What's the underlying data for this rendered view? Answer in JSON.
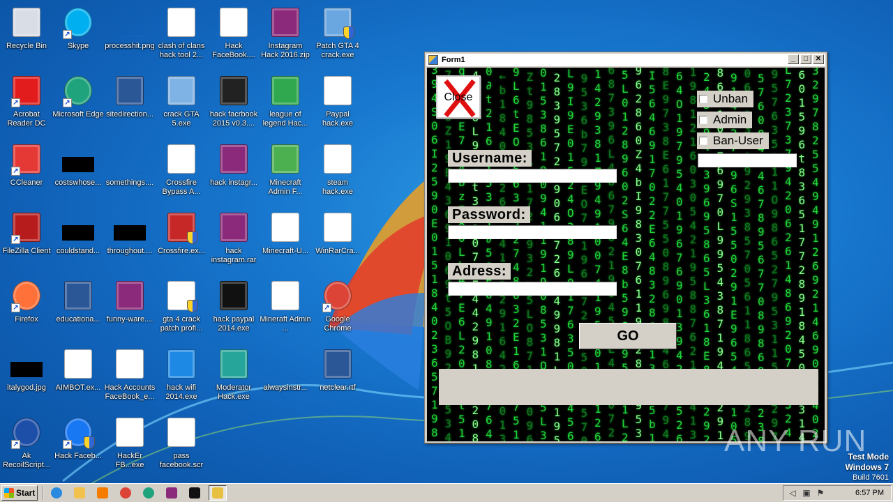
{
  "desktop": {
    "icons": [
      {
        "label": "Recycle Bin",
        "icon": "recycle-bin-icon",
        "color": "#d8dde6"
      },
      {
        "label": "Skype",
        "icon": "skype-icon",
        "color": "#00aff0"
      },
      {
        "label": "processhit.png",
        "icon": "image-file-icon",
        "color": "#1565c0"
      },
      {
        "label": "clash of clans hack tool 2...",
        "icon": "window-app-icon",
        "color": "#ffffff"
      },
      {
        "label": "Hack FaceBook....",
        "icon": "video-file-icon",
        "color": "#ffffff"
      },
      {
        "label": "Instagram Hack 2016.zip",
        "icon": "winrar-icon",
        "color": "#8b2a7a"
      },
      {
        "label": "Patch GTA 4 crack.exe",
        "icon": "installer-icon",
        "color": "#6aa6e0"
      },
      {
        "label": "Acrobat Reader DC",
        "icon": "acrobat-icon",
        "color": "#e21c1c"
      },
      {
        "label": "Microsoft Edge",
        "icon": "edge-icon",
        "color": "#1fa37d"
      },
      {
        "label": "sitedirection...",
        "icon": "word-doc-icon",
        "color": "#2b5797"
      },
      {
        "label": "crack GTA 5.exe",
        "icon": "media-exe-icon",
        "color": "#7fb2e5"
      },
      {
        "label": "hack facrbook 2015  v0.3....",
        "icon": "dark-image-icon",
        "color": "#222222"
      },
      {
        "label": "league of legend Hac...",
        "icon": "shield-check-icon",
        "color": "#2fa84f"
      },
      {
        "label": "Paypal hack.exe",
        "icon": "exe-file-icon",
        "color": "#ffffff"
      },
      {
        "label": "CCleaner",
        "icon": "ccleaner-icon",
        "color": "#e53935"
      },
      {
        "label": "costswhose...",
        "icon": "black-image-icon",
        "color": "#000000"
      },
      {
        "label": "somethings....",
        "icon": "image-file-icon",
        "color": "#1565c0"
      },
      {
        "label": "Crossfire Bypass A...",
        "icon": "window-app-icon",
        "color": "#ffffff"
      },
      {
        "label": "hack instagr...",
        "icon": "winrar-icon",
        "color": "#8b2a7a"
      },
      {
        "label": "Minecraft Admin F...",
        "icon": "droplet-icon",
        "color": "#4caf50"
      },
      {
        "label": "steam hack.exe",
        "icon": "exe-file-icon",
        "color": "#ffffff"
      },
      {
        "label": "FileZilla Client",
        "icon": "filezilla-icon",
        "color": "#b71c1c"
      },
      {
        "label": "couldstand...",
        "icon": "black-image-icon",
        "color": "#000000"
      },
      {
        "label": "throughout....",
        "icon": "black-image-icon",
        "color": "#000000"
      },
      {
        "label": "Crossfire.ex...",
        "icon": "crossfire-icon",
        "color": "#c62828"
      },
      {
        "label": "hack instagram.rar",
        "icon": "winrar-icon",
        "color": "#8b2a7a"
      },
      {
        "label": "Minecraft-U...",
        "icon": "window-app-icon",
        "color": "#ffffff"
      },
      {
        "label": "WinRarCra...",
        "icon": "exe-file-icon",
        "color": "#ffffff"
      },
      {
        "label": "Firefox",
        "icon": "firefox-icon",
        "color": "#ff7139"
      },
      {
        "label": "educationa...",
        "icon": "word-doc-icon",
        "color": "#2b5797"
      },
      {
        "label": "funny-ware....",
        "icon": "winrar-icon",
        "color": "#8b2a7a"
      },
      {
        "label": "gta 4 crack patch profi...",
        "icon": "installer-icon",
        "color": "#ffffff"
      },
      {
        "label": "hack paypal 2014.exe",
        "icon": "pirate-icon",
        "color": "#111111"
      },
      {
        "label": "Mineraft Admin ...",
        "icon": "exe-file-icon",
        "color": "#ffffff"
      },
      {
        "label": "Google Chrome",
        "icon": "chrome-icon",
        "color": "#db4437"
      },
      {
        "label": "italygod.jpg",
        "icon": "black-image-icon",
        "color": "#000000"
      },
      {
        "label": "AIMBOT.ex...",
        "icon": "gear-file-icon",
        "color": "#ffffff"
      },
      {
        "label": "Hack Accounts FaceBook_e...",
        "icon": "exe-file-icon",
        "color": "#ffffff"
      },
      {
        "label": "hack wifi 2014.exe",
        "icon": "wifi-icon",
        "color": "#1e88e5"
      },
      {
        "label": "Moderator Hack.exe",
        "icon": "cartoon-icon",
        "color": "#26a69a"
      },
      {
        "label": "alwaysinstr...",
        "icon": "image-file-icon",
        "color": "#1565c0"
      },
      {
        "label": "netclear.rtf",
        "icon": "word-doc-icon",
        "color": "#2b5797"
      },
      {
        "label": "Ak RecoilScript...",
        "icon": "gear-app-icon",
        "color": "#1e4fa8"
      },
      {
        "label": "Hack Faceb...",
        "icon": "facebook-icon",
        "color": "#1877f2"
      },
      {
        "label": "HackEr FB...exe",
        "icon": "exe-file-icon",
        "color": "#ffffff"
      },
      {
        "label": "pass facebook.scr",
        "icon": "window-app-icon",
        "color": "#ffffff"
      }
    ]
  },
  "form": {
    "title": "Form1",
    "close_label": "Close",
    "username_label": "Username:",
    "username_value": "",
    "password_label": "Password:",
    "password_value": "",
    "address_label": "Adress:",
    "address_value": "",
    "unban_label": "Unban",
    "admin_label": "Admin",
    "banuser_label": "Ban-User",
    "side_input_value": "",
    "go_label": "GO",
    "output_text": ""
  },
  "watermark": {
    "text": "ANY RUN",
    "mode": "Test Mode",
    "os": "Windows 7",
    "build": "Build 7601"
  },
  "taskbar": {
    "start_label": "Start",
    "clock": "6:57 PM",
    "apps": [
      {
        "icon": "ie-icon",
        "color": "#2a8ae0"
      },
      {
        "label": "explorer",
        "icon": "folder-icon",
        "color": "#f2c14e"
      },
      {
        "icon": "media-player-icon",
        "color": "#f57c00"
      },
      {
        "icon": "chrome-icon",
        "color": "#db4437"
      },
      {
        "icon": "edge-icon",
        "color": "#1fa37d"
      },
      {
        "icon": "winrar-icon",
        "color": "#8b2a7a"
      },
      {
        "icon": "pirate-icon",
        "color": "#111111"
      },
      {
        "icon": "form-app-icon",
        "color": "#e8c040"
      }
    ]
  },
  "matrix": {
    "columns": [
      "3\n9\n4\nS\n0\n6\nI\n2\n5\n9\n0\nE\n0\n1\n5\n1\n8\n4\n0\n2\n3\n6\n5\n7\n1\n9\n8",
      "7\nd\n2\n8\nZ\n1\n9\nE\n4\n3\n6\n9\n1\n0\n6\n9\nt\n5\nO\nB\n9\n2\n1\n6\n5\n3\n4",
      "q\n1\n5\n0\nE\n7\n3\n4\nb\nz\n7\n8\n0\nL\nb\n4\n7\nE\n6\nL\n2\n0\n9\nS\nt\n5\n1",
      "4\nO\n1\n6\nL\n9\n1\n8\nt\n3\n4\n1\n0\n7\n9\nE\n4\n4\n2\n9\n8\n1\n6\n5\n2\n0\n8",
      "0\n∂\nt\n2\n1\n6\n9\nI\n5\n3\n8\n1\n∂\n5\n0\nE\n6\n4\n9\n1\n0\n8\n2\n5\n7\n6\n4",
      "←\nb\n1\n8\n4\n0\n9\n3\n2\n6\n1\n4\n4\n1\n7\n3\n2\n9\n1\n6\n4\n2\n3\n5\n0\n1\n3",
      "9\nL\n6\nt\nE\nO\n1\n6\n6\n3\n5\n2\n2\n7\n4\n8\n0\n3\n2\nE\n1\n6\n9\n8\n7\n5\n1",
      "Z\nt\n9\n8\n5\n3\nL\n0\n1\n7\n2\n4\n9\n3\n2\nb\n5\nL\nO\n8\n7\n1\n6\n2\n0\n9\n6",
      "0\n1\n5\n3\n8\n6\n1\n9\n0\n9\n4\n1\n1\n9\n1\n9\n0\n8\n5\n3\n1\nO\n9\n9\n5\nL\n3",
      "2\n8\n3\n9\n5\n7\n2\n1\n9\n0\n6\nb\n7\n2\n6\n1\n4\n9\n9\n8\n1\nL\n6\n4\n1\n9\n5",
      "L\n9\nI\n9\nE\n0\n1\n5\n2\n4\nO\n3\n8\n9\nL\n0\n1\n7\n6\n3\n5\n0\n9\n7\n4\n5\n6",
      "9\n5\n3\n6\nb\n7\n9\n4\nE\nO\n7\nt\n1\n9\n6\n6\n7\n2\n1\n4\n5\n0\n3\n8\n5\n7\n0",
      "1\n4\n2\n9\n3\n8\n1\nZ\n9\n4\n9\n1\n0\n0\n7\n4\n1\n9\n5\n7\n0\n1\n2\n2\n1\n2\n6",
      "6\n8\n7\n3\n9\n6\nL\n4\n8\n6\n7\n9\n6\n2\n1\n9\n0\n4\n5\n9\nL\n4\n4\n8\n0\n7\n2",
      "5\nL\n0\n1\n2\n8\n9\n6\n0\n2\nS\n6\n4\nE\n8\nb\n5\n9\n0\n7\n9\n5\n3\n1\n1\nL\n2",
      "9\n6\n2\n8\n6\n0\nZ\n4\nb\nI\n9\n8\n3\n0\n7\n6\n1\n1\n9\n5\n2\n8\n1\n8\n9\n5\n3",
      "I\n5\n6\n4\n6\n9\n1\n7\n0\n2\n2\nE\n6\n4\n8\n3\n2\n8\n6\nZ\n1\n3\n4\n1\n5\nb\n1",
      "8\nE\n9\n7\n3\n8\nE\n6\n1\n7\n7\n5\n5\n0\n8\n9\n6\n9\n8\n5\n4\n6\n2\n8\n7\n9\n4",
      "6\n4\nO\n1\n9\n7\n9\n5\n4\n0\n1\n9\n6\n7\n6\n9\n0\n1\n3\n9\n4\n2\n3\n9\n5\n2\n6",
      "1\n9\n8\n1\n2\n1\n6\n0\n3\n0\n5\n4\n2\n1\n9\n5\n8\n8\n7\n6\n2\n1\n0\n6\n4\n1\n3",
      "2\n4\n3\n6\n9\n4\n0\n3\n9\n6\n9\n5\n8\n6\n5\nL\n3\n6\n1\n8\nE\n8\n3\n5\n2\n9\n2",
      "8\n6\n1\n1\n0\n9\n7\n6\n9\n7\n0\nL\n9\n9\n5\n4\n3\n8\n7\n1\n9\n4\n6\n8\n2\n9\n1",
      "9\n1\n4\n7\n2\n7\nE\n9\n6\nS\n1\n5\n5\n0\n2\n9\n1\nE\n9\n6\n5\n4\n3\n9\n1\n0\n5",
      "0\n6\n3\n2\n3\n6\n1\n9\n2\n9\n3\n8\n5\n7\n0\n5\n6\n1\n1\n8\n6\n5\n0\n6\n2\n8\n9",
      "5\n7\n6\n0\n8\n4\n1\n4\n6\n7\n8\n9\n5\n6\n7\n7\n0\n8\n9\n8\n6\n9\n0\n5\n2\n3\n8",
      "9\n5\n7\n6\n3\n5\n0\n1\n1\nO\n9\n8\n6\n5\n2\n7\n9\n5\n3\n1\n1\n5\n4\n6\n2\n9\n7",
      "L\n7\n2\n3\n7\n3\n7\n9\n4\n2\n0\n6\n2\n6\n1\n4\n8\n6\n9\n2\n0\n7\n1\n9\n3\n2\n4",
      "6\n0\n1\n5\n9\n6\nt\n8\n3\n6\n5\n1\n7\n7\n2\n8\n9\n1\n8\n4\n5\n0\n7\n0\n3\n1\n4",
      "3\n2\n9\n7\n8\n2\n5\n5\n4\n9\n4\n9\n1\n2\n6\n9\n2\n1\n4\n6\n9\n0\n8\n2\n4\n0\n2"
    ]
  }
}
